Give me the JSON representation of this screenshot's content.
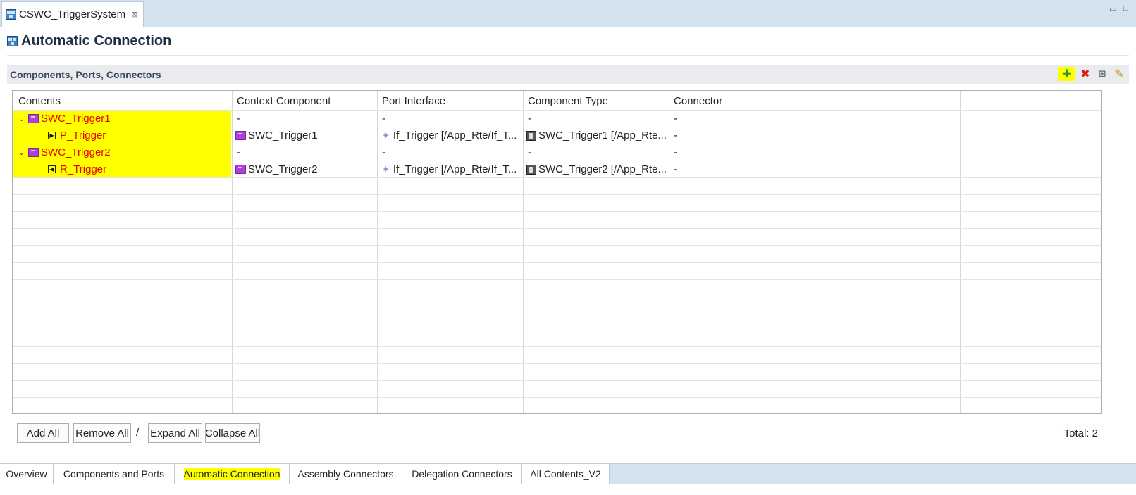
{
  "editor_tab": {
    "title": "CSWC_TriggerSystem",
    "close": "⊠"
  },
  "window_controls": {
    "minimize": "▭",
    "maximize": "□"
  },
  "page": {
    "title": "Automatic Connection"
  },
  "section": {
    "title": "Components, Ports, Connectors",
    "tools": [
      {
        "name": "add-icon",
        "glyph": "✚"
      },
      {
        "name": "delete-icon",
        "glyph": "✖"
      },
      {
        "name": "grid-icon",
        "glyph": "⊞"
      },
      {
        "name": "edit-icon",
        "glyph": "✎"
      }
    ]
  },
  "table": {
    "columns": [
      "Contents",
      "Context Component",
      "Port Interface",
      "Component Type",
      "Connector"
    ],
    "rows": [
      {
        "level": 0,
        "expand": "⌄",
        "kind": "component",
        "content": "SWC_Trigger1",
        "context": "-",
        "iface": "-",
        "type": "-",
        "connector": "-"
      },
      {
        "level": 1,
        "kind": "provided-port",
        "port_glyph": "▶",
        "content": "P_Trigger",
        "context": "SWC_Trigger1",
        "iface": "If_Trigger [/App_Rte/If_T...",
        "type": "SWC_Trigger1 [/App_Rte...",
        "connector": "-"
      },
      {
        "level": 0,
        "expand": "⌄",
        "kind": "component",
        "content": "SWC_Trigger2",
        "context": "-",
        "iface": "-",
        "type": "-",
        "connector": "-"
      },
      {
        "level": 1,
        "kind": "required-port",
        "port_glyph": "◀",
        "content": "R_Trigger",
        "context": "SWC_Trigger2",
        "iface": "If_Trigger [/App_Rte/If_T...",
        "type": "SWC_Trigger2 [/App_Rte...",
        "connector": "-"
      }
    ]
  },
  "buttons": {
    "add_all": "Add All",
    "remove_all": "Remove All",
    "separator": "/",
    "expand_all": "Expand All",
    "collapse_all": "Collapse All"
  },
  "status": {
    "total": "Total: 2"
  },
  "page_tabs": [
    {
      "label": "Overview",
      "active": false
    },
    {
      "label": "Components and Ports",
      "active": false
    },
    {
      "label": "Automatic Connection",
      "active": true
    },
    {
      "label": "Assembly Connectors",
      "active": false
    },
    {
      "label": "Delegation Connectors",
      "active": false
    },
    {
      "label": "All Contents_V2",
      "active": false
    }
  ]
}
